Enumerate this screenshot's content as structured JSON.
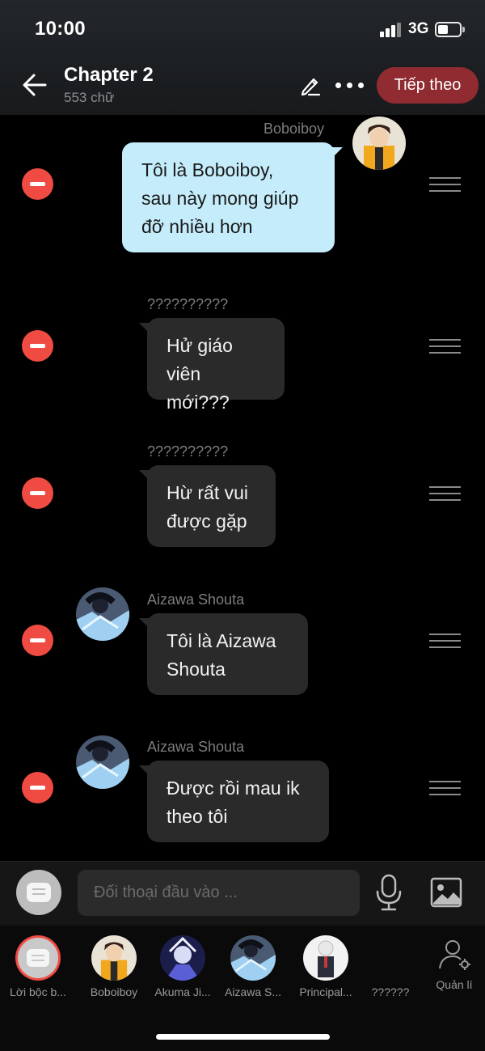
{
  "status_bar": {
    "time": "10:00",
    "network": "3G"
  },
  "header": {
    "title": "Chapter 2",
    "word_count": "553 chữ",
    "next_label": "Tiếp theo"
  },
  "messages": [
    {
      "speaker": "Boboiboy",
      "text_lines": [
        "Tôi là Boboiboy,",
        "sau này mong giúp",
        "đỡ nhiều hơn"
      ],
      "side": "right"
    },
    {
      "speaker": "??????????",
      "text_lines": [
        "Hử giáo",
        "viên mới???"
      ],
      "side": "left"
    },
    {
      "speaker": "??????????",
      "text_lines": [
        "Hừ rất vui",
        "được gặp"
      ],
      "side": "left"
    },
    {
      "speaker": "Aizawa Shouta",
      "text_lines": [
        "Tôi là Aizawa",
        "Shouta"
      ],
      "side": "left"
    },
    {
      "speaker": "Aizawa Shouta",
      "text_lines": [
        "Được rồi mau ik",
        "theo tôi"
      ],
      "side": "left"
    }
  ],
  "composer": {
    "placeholder": "Đối thoại đầu vào ..."
  },
  "characters": [
    {
      "label": "Lời bộc b..."
    },
    {
      "label": "Boboiboy"
    },
    {
      "label": "Akuma Ji..."
    },
    {
      "label": "Aizawa S..."
    },
    {
      "label": "Principal..."
    },
    {
      "label": "??????"
    }
  ],
  "manage_label": "Quản lí",
  "colors": {
    "accent": "#8f2b31",
    "delete": "#ef4b43",
    "own_bubble": "#c5ecfb",
    "other_bubble": "#2a2a2a"
  }
}
